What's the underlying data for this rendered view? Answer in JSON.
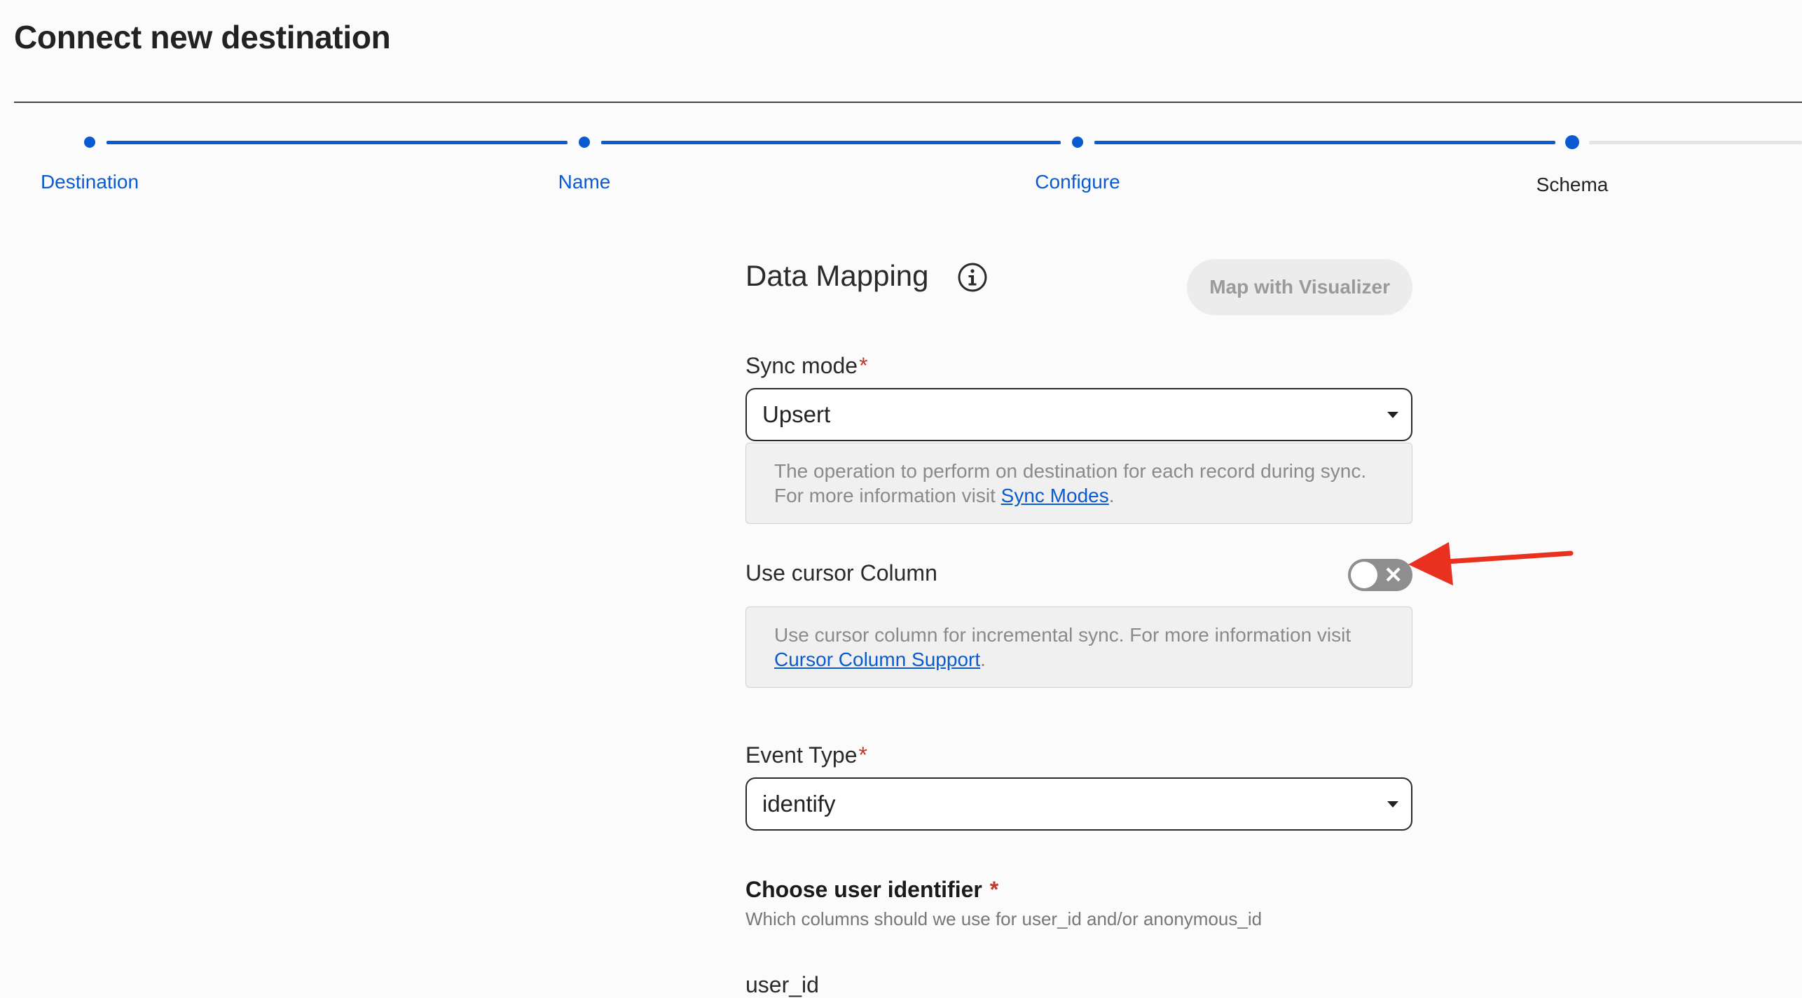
{
  "header": {
    "title": "Connect new destination"
  },
  "stepper": {
    "steps": [
      {
        "label": "Destination",
        "state": "done"
      },
      {
        "label": "Name",
        "state": "done"
      },
      {
        "label": "Configure",
        "state": "done"
      },
      {
        "label": "Schema",
        "state": "current"
      }
    ],
    "accent_color": "#0a5bd1"
  },
  "data_mapping": {
    "title": "Data Mapping",
    "info_icon": "info-icon",
    "visualizer_button": "Map with Visualizer"
  },
  "sync_mode": {
    "label": "Sync mode",
    "required": "*",
    "value": "Upsert",
    "help_text": "The operation to perform on destination for each record during sync. For more information visit ",
    "help_link": "Sync Modes",
    "help_suffix": "."
  },
  "cursor_column": {
    "label": "Use cursor Column",
    "toggle_on": false,
    "toggle_icon": "close-icon",
    "help_text": "Use cursor column for incremental sync. For more information visit ",
    "help_link": "Cursor Column Support",
    "help_suffix": "."
  },
  "event_type": {
    "label": "Event Type",
    "required": "*",
    "value": "identify"
  },
  "user_identifier": {
    "title": "Choose user identifier",
    "required": "*",
    "subtitle": "Which columns should we use for user_id and/or anonymous_id",
    "first_field_label": "user_id"
  },
  "annotation": {
    "arrow_color": "#e8321f"
  }
}
